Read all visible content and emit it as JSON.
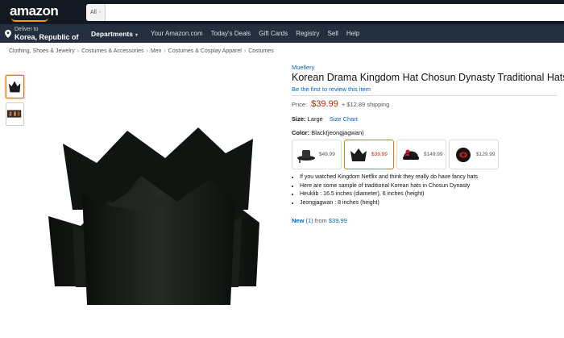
{
  "header": {
    "logo": "amazon",
    "search_category": "All",
    "search_placeholder": ""
  },
  "nav": {
    "deliver_to": "Deliver to",
    "location": "Korea, Republic of",
    "departments": "Departments",
    "links": [
      "Your Amazon.com",
      "Today's Deals",
      "Gift Cards",
      "Registry",
      "Sell",
      "Help"
    ]
  },
  "breadcrumb": [
    "Clothing, Shoes & Jewelry",
    "Costumes & Accessories",
    "Men",
    "Costumes & Cosplay Apparel",
    "Costumes"
  ],
  "product": {
    "brand": "Muellery",
    "title": "Korean Drama Kingdom Hat Chosun Dynasty Traditional Hats",
    "review_link": "Be the first to review this item",
    "price_label": "Price:",
    "price": "$39.99",
    "shipping": "+ $12.89 shipping",
    "size_label": "Size:",
    "size_value": "Large",
    "size_chart": "Size Chart",
    "color_label": "Color:",
    "color_value": "Black(jeongjagwan)",
    "swatches": [
      {
        "price": "$49.99",
        "icon": "gat-hat-icon"
      },
      {
        "price": "$39.99",
        "icon": "crown-hat-icon"
      },
      {
        "price": "$149.99",
        "icon": "red-hat-icon"
      },
      {
        "price": "$129.99",
        "icon": "round-hat-icon"
      }
    ],
    "bullets": [
      "If you watched Kingdom Netflix and think they really do have fancy hats",
      "Here are some sample of traditional Korean hats in Chosun Dynasty",
      "Heuklib : 16.5 inches (diameter), 6 inches (height)",
      "Jeongjagwan : 8 inches (height)"
    ],
    "new_label": "New",
    "new_count": "(1)",
    "new_from": "from",
    "new_price": "$39.99"
  },
  "colors": {
    "top_bar": "#131921",
    "nav_bar": "#232f3e",
    "link": "#0066c0",
    "price": "#b12704",
    "selected": "#e77600"
  }
}
